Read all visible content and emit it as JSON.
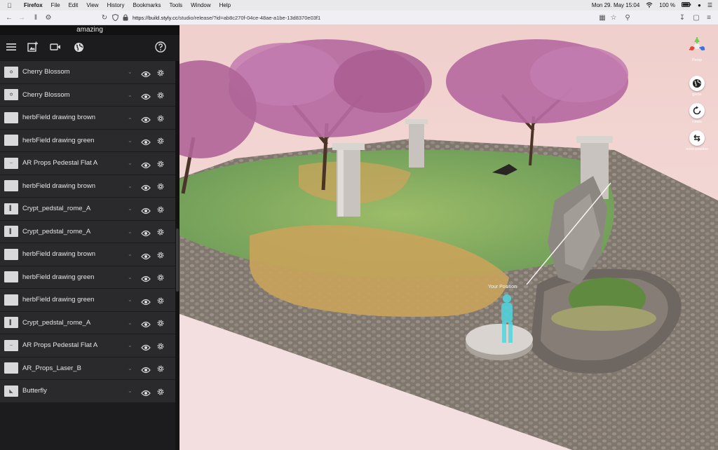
{
  "menubar": {
    "app": "Firefox",
    "items": [
      "File",
      "Edit",
      "View",
      "History",
      "Bookmarks",
      "Tools",
      "Window",
      "Help"
    ],
    "clock": "Mon 29. May  15:04",
    "battery": "100 %"
  },
  "browser": {
    "url_host": "https://build.styly.cc",
    "url_path": "/studio/release/?id=ab8c270f-04ce-48ae-a1be-13d8370e03f1"
  },
  "panel": {
    "scene_title": "amazing",
    "layers": [
      {
        "name": "Cherry Blossom",
        "thumb": "tree"
      },
      {
        "name": "Cherry Blossom",
        "thumb": "tree"
      },
      {
        "name": "herbField drawing brown",
        "thumb": "blank"
      },
      {
        "name": "herbField drawing green",
        "thumb": "blank"
      },
      {
        "name": "AR Props Pedestal Flat A",
        "thumb": "flat"
      },
      {
        "name": "herbField drawing brown",
        "thumb": "blank"
      },
      {
        "name": "Crypt_pedstal_rome_A",
        "thumb": "pillar"
      },
      {
        "name": "Crypt_pedstal_rome_A",
        "thumb": "pillar"
      },
      {
        "name": "herbField drawing brown",
        "thumb": "blank"
      },
      {
        "name": "herbField drawing green",
        "thumb": "blank"
      },
      {
        "name": "herbField drawing green",
        "thumb": "blank"
      },
      {
        "name": "Crypt_pedstal_rome_A",
        "thumb": "pillar"
      },
      {
        "name": "AR Props Pedestal Flat A",
        "thumb": "flat"
      },
      {
        "name": "AR_Props_Laser_B",
        "thumb": "blank"
      },
      {
        "name": "Butterfly",
        "thumb": "butterfly"
      }
    ]
  },
  "viewport": {
    "tools": [
      {
        "icon": "perspective-gizmo-icon",
        "label": "Persp"
      },
      {
        "icon": "globe-icon",
        "label": "globe"
      },
      {
        "icon": "rotate-icon",
        "label": "rotate"
      },
      {
        "icon": "reset-position-icon",
        "label": "reset position"
      }
    ],
    "your_position_label": "Your Position"
  },
  "colors": {
    "panel_bg": "#1c1c1e",
    "row_bg": "#2a2a2d",
    "sky": "#f3d5d2",
    "ground": "#8a8178",
    "grass": "#7fae62",
    "blossom": "#b86aa0",
    "avatar": "#4fd6e0"
  }
}
